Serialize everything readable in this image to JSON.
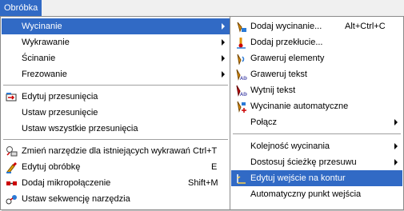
{
  "menubar": {
    "active_label": "Obróbka"
  },
  "menu1": {
    "items": [
      {
        "label": "Wycinanie",
        "shortcut": "",
        "submenu": true,
        "selected": true,
        "icon": ""
      },
      {
        "label": "Wykrawanie",
        "shortcut": "",
        "submenu": true,
        "icon": ""
      },
      {
        "label": "Ścinanie",
        "shortcut": "",
        "submenu": true,
        "icon": ""
      },
      {
        "label": "Frezowanie",
        "shortcut": "",
        "submenu": true,
        "icon": ""
      },
      {
        "label": "Edytuj przesunięcia",
        "shortcut": "",
        "icon": "edit-offsets-icon"
      },
      {
        "label": "Ustaw przesunięcie",
        "shortcut": "",
        "icon": ""
      },
      {
        "label": "Ustaw wszystkie przesunięcia",
        "shortcut": "",
        "icon": ""
      },
      {
        "label": "Zmień narzędzie dla istniejących wykrawań",
        "shortcut": "Ctrl+T",
        "icon": "change-tool-icon"
      },
      {
        "label": "Edytuj obróbkę",
        "shortcut": "E",
        "icon": "edit-machining-icon"
      },
      {
        "label": "Dodaj mikropołączenie",
        "shortcut": "Shift+M",
        "icon": "microjoint-icon"
      },
      {
        "label": "Ustaw sekwencję narzędzia",
        "shortcut": "",
        "icon": "tool-sequence-icon"
      }
    ]
  },
  "menu2": {
    "items": [
      {
        "label": "Dodaj wycinanie...",
        "shortcut": "Alt+Ctrl+C",
        "icon": "add-cut-icon"
      },
      {
        "label": "Dodaj przekłucie...",
        "shortcut": "",
        "icon": "add-pierce-icon"
      },
      {
        "label": "Graweruj elementy",
        "shortcut": "",
        "icon": "engrave-elements-icon"
      },
      {
        "label": "Graweruj tekst",
        "shortcut": "",
        "icon": "engrave-text-icon"
      },
      {
        "label": "Wytnij tekst",
        "shortcut": "",
        "icon": "cut-text-icon"
      },
      {
        "label": "Wycinanie automatyczne",
        "shortcut": "",
        "icon": "auto-cut-icon"
      },
      {
        "label": "Połącz",
        "shortcut": "",
        "submenu": true,
        "icon": ""
      },
      {
        "label": "Kolejność wycinania",
        "shortcut": "",
        "submenu": true,
        "icon": ""
      },
      {
        "label": "Dostosuj ścieżkę przesuwu",
        "shortcut": "",
        "submenu": true,
        "icon": ""
      },
      {
        "label": "Edytuj wejście na kontur",
        "shortcut": "",
        "selected": true,
        "icon": "edit-lead-in-icon"
      },
      {
        "label": "Automatyczny punkt wejścia",
        "shortcut": "",
        "icon": ""
      }
    ]
  }
}
